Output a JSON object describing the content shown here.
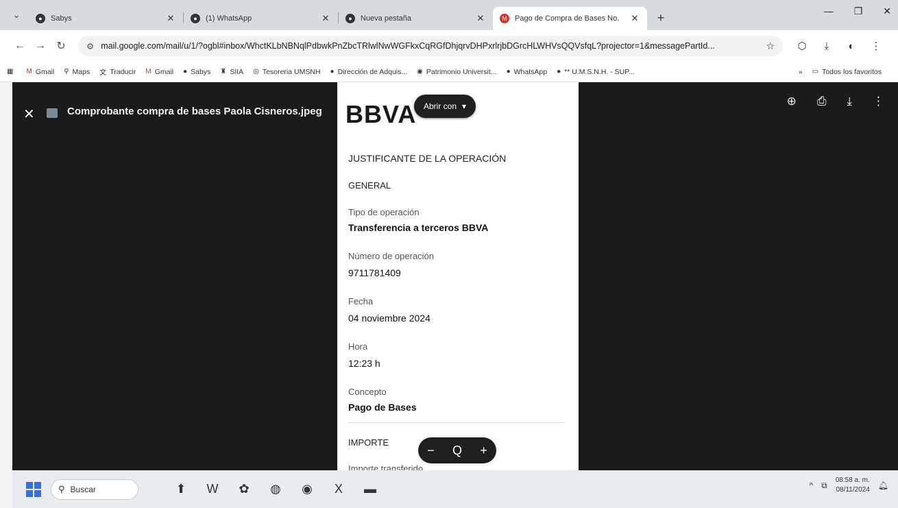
{
  "browser": {
    "tabs": [
      {
        "title": "Sabys",
        "icon": "sabys-icon",
        "active": false
      },
      {
        "title": "(1) WhatsApp",
        "icon": "whatsapp-icon",
        "active": false
      },
      {
        "title": "Nueva pestaña",
        "icon": "chrome-icon",
        "active": false
      },
      {
        "title": "Pago de Compra de Bases No.",
        "icon": "gmail-icon",
        "active": true
      }
    ],
    "new_tab": "+",
    "url": "mail.google.com/mail/u/1/?ogbl#inbox/WhctKLbNBNqlPdbwkPnZbcTRlwlNwWGFkxCqRGfDhjqrvDHPxrlrjbDGrcHLWHVsQQVsfqL?projector=1&messagePartId...",
    "bookmarks": [
      "Gmail",
      "Maps",
      "Traducir",
      "Gmail",
      "Sabys",
      "SIIA",
      "Tesoreria UMSNH",
      "Dirección de Adquis...",
      "Patrimonio Universit...",
      "WhatsApp",
      "** U.M.S.N.H. - SUP..."
    ],
    "bookmarks_overflow": "»",
    "all_bookmarks": "Todos los favoritos"
  },
  "viewer": {
    "file_name": "Comprobante compra de bases Paola Cisneros.jpeg",
    "open_with": "Abrir con",
    "zoom_out": "−",
    "zoom_icon": "Q",
    "zoom_in": "+"
  },
  "receipt": {
    "logo": "BBVA",
    "heading": "JUSTIFICANTE DE LA OPERACIÓN",
    "section": "GENERAL",
    "fields": [
      {
        "label": "Tipo de operación",
        "value": "Transferencia a terceros BBVA"
      },
      {
        "label": "Número de operación",
        "value": "9711781409"
      },
      {
        "label": "Fecha",
        "value": "04 noviembre 2024"
      },
      {
        "label": "Hora",
        "value": "12:23 h"
      },
      {
        "label": "Concepto",
        "value": "Pago de Bases"
      }
    ],
    "importe_section": "IMPORTE",
    "importe_label": "Importe transferido"
  },
  "taskbar": {
    "search_placeholder": "Buscar",
    "time": "08:58 a. m.",
    "date": "08/11/2024"
  }
}
